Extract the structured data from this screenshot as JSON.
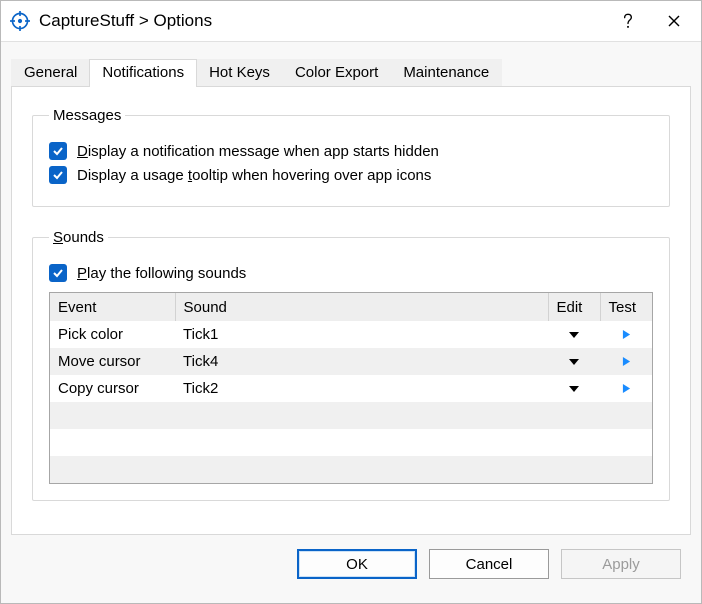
{
  "window": {
    "title": "CaptureStuff > Options"
  },
  "tabs": {
    "general": "General",
    "notifications": "Notifications",
    "hotkeys": "Hot Keys",
    "colorexport": "Color Export",
    "maintenance": "Maintenance",
    "active": "notifications"
  },
  "messages": {
    "legend": "Messages",
    "display_start_hidden": "isplay a notification message when app starts hidden",
    "display_start_hidden_mn": "D",
    "display_tooltip_pre": "Display a usage ",
    "display_tooltip_mn": "t",
    "display_tooltip_post": "ooltip when hovering over app icons"
  },
  "sounds": {
    "legend_mn": "S",
    "legend_rest": "ounds",
    "play_mn": "P",
    "play_rest": "lay the following sounds",
    "headers": {
      "event": "Event",
      "sound": "Sound",
      "edit": "Edit",
      "test": "Test"
    },
    "rows": [
      {
        "event": "Pick color",
        "sound": "Tick1"
      },
      {
        "event": "Move cursor",
        "sound": "Tick4"
      },
      {
        "event": "Copy cursor",
        "sound": "Tick2"
      }
    ]
  },
  "buttons": {
    "ok": "OK",
    "cancel": "Cancel",
    "apply": "Apply"
  }
}
